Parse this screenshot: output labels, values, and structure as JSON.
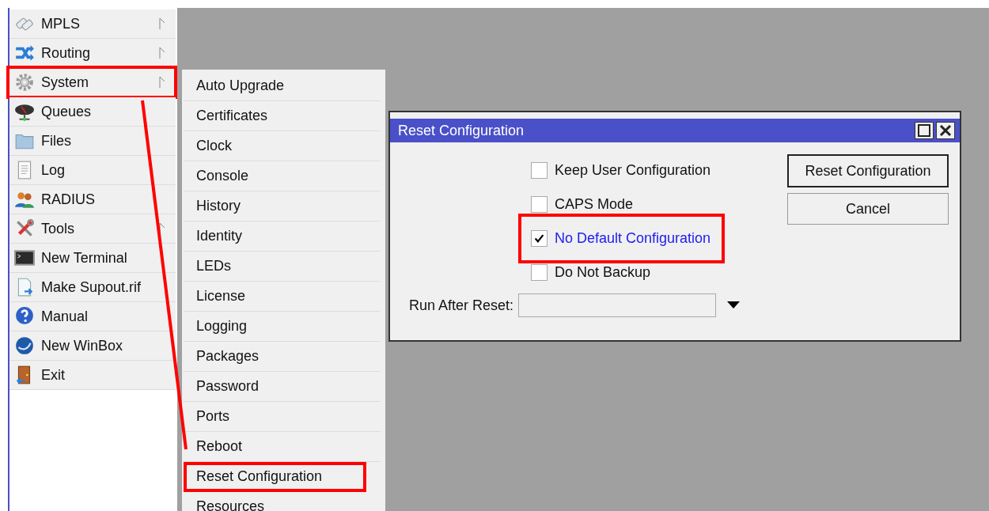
{
  "menu": {
    "items": [
      {
        "label": "MPLS",
        "has_submenu": true,
        "highlighted": false
      },
      {
        "label": "Routing",
        "has_submenu": true,
        "highlighted": false
      },
      {
        "label": "System",
        "has_submenu": true,
        "highlighted": true
      },
      {
        "label": "Queues",
        "has_submenu": false,
        "highlighted": false
      },
      {
        "label": "Files",
        "has_submenu": false,
        "highlighted": false
      },
      {
        "label": "Log",
        "has_submenu": false,
        "highlighted": false
      },
      {
        "label": "RADIUS",
        "has_submenu": false,
        "highlighted": false
      },
      {
        "label": "Tools",
        "has_submenu": true,
        "highlighted": false
      },
      {
        "label": "New Terminal",
        "has_submenu": false,
        "highlighted": false
      },
      {
        "label": "Make Supout.rif",
        "has_submenu": false,
        "highlighted": false
      },
      {
        "label": "Manual",
        "has_submenu": false,
        "highlighted": false
      },
      {
        "label": "New WinBox",
        "has_submenu": false,
        "highlighted": false
      },
      {
        "label": "Exit",
        "has_submenu": false,
        "highlighted": false
      }
    ]
  },
  "submenu": {
    "items": [
      {
        "label": "Auto Upgrade",
        "highlighted": false
      },
      {
        "label": "Certificates",
        "highlighted": false
      },
      {
        "label": "Clock",
        "highlighted": false
      },
      {
        "label": "Console",
        "highlighted": false
      },
      {
        "label": "History",
        "highlighted": false
      },
      {
        "label": "Identity",
        "highlighted": false
      },
      {
        "label": "LEDs",
        "highlighted": false
      },
      {
        "label": "License",
        "highlighted": false
      },
      {
        "label": "Logging",
        "highlighted": false
      },
      {
        "label": "Packages",
        "highlighted": false
      },
      {
        "label": "Password",
        "highlighted": false
      },
      {
        "label": "Ports",
        "highlighted": false
      },
      {
        "label": "Reboot",
        "highlighted": false
      },
      {
        "label": "Reset Configuration",
        "highlighted": true
      },
      {
        "label": "Resources",
        "highlighted": false
      }
    ]
  },
  "dialog": {
    "title": "Reset Configuration",
    "options": [
      {
        "label": "Keep User Configuration",
        "checked": false,
        "focused": false,
        "highlighted": false
      },
      {
        "label": "CAPS Mode",
        "checked": false,
        "focused": false,
        "highlighted": false
      },
      {
        "label": "No Default Configuration",
        "checked": true,
        "focused": true,
        "highlighted": true
      },
      {
        "label": "Do Not Backup",
        "checked": false,
        "focused": false,
        "highlighted": false
      }
    ],
    "run_after_reset": {
      "label": "Run After Reset:"
    },
    "buttons": [
      {
        "label": "Reset Configuration",
        "default": true
      },
      {
        "label": "Cancel",
        "default": false
      }
    ]
  }
}
